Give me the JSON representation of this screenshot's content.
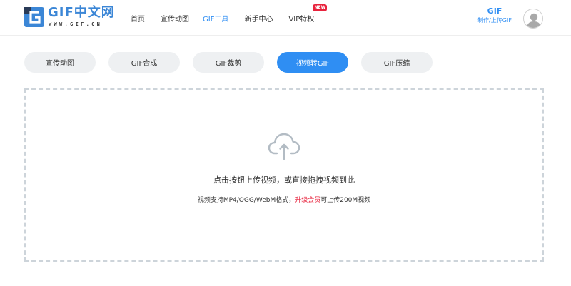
{
  "header": {
    "logo": {
      "text": "GIF中文网",
      "sub": "WWW.GIF.CN"
    },
    "nav": [
      {
        "label": "首页",
        "active": false
      },
      {
        "label": "宣传动图",
        "active": false
      },
      {
        "label": "GIF工具",
        "active": true
      },
      {
        "label": "新手中心",
        "active": false
      },
      {
        "label": "VIP特权",
        "active": false,
        "badge": "NEW"
      }
    ],
    "make_gif": {
      "title": "GIF",
      "subtitle": "制作/上传GIF"
    },
    "avatar_icon": "user-avatar-icon"
  },
  "tabs": [
    {
      "label": "宣传动图",
      "active": false
    },
    {
      "label": "GIF合成",
      "active": false
    },
    {
      "label": "GIF裁剪",
      "active": false
    },
    {
      "label": "视频转GIF",
      "active": true
    },
    {
      "label": "GIF压缩",
      "active": false
    }
  ],
  "upload": {
    "icon": "cloud-upload-icon",
    "main_text": "点击按钮上传视频，或直接拖拽视频到此",
    "sub_text_before": "视频支持MP4/OGG/WebM格式，",
    "sub_text_link": "升级会员",
    "sub_text_after": "可上传200M视频"
  },
  "colors": {
    "accent": "#2f8ef3",
    "logo_blue": "#3b86d6",
    "badge_red": "#e8233d",
    "tab_bg": "#eef0f2",
    "dashed_border": "#cdd4da",
    "cloud_icon": "#b3bcc4"
  }
}
